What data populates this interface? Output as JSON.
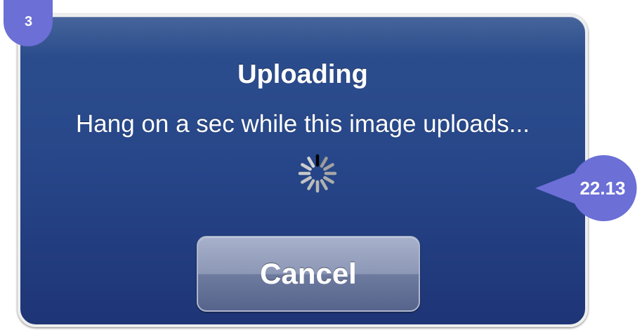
{
  "dialog": {
    "title": "Uploading",
    "message": "Hang on a sec while this image uploads...",
    "spinner_icon": "activity-spinner-icon",
    "cancel_label": "Cancel"
  },
  "annotations": {
    "step_number": "3",
    "timer_value": "22.13"
  },
  "colors": {
    "dialog_background": "#27478a",
    "dialog_border": "#eeeeee",
    "button_background": "#8c97b6",
    "text": "#ffffff",
    "badge": "#6b6fd6"
  }
}
